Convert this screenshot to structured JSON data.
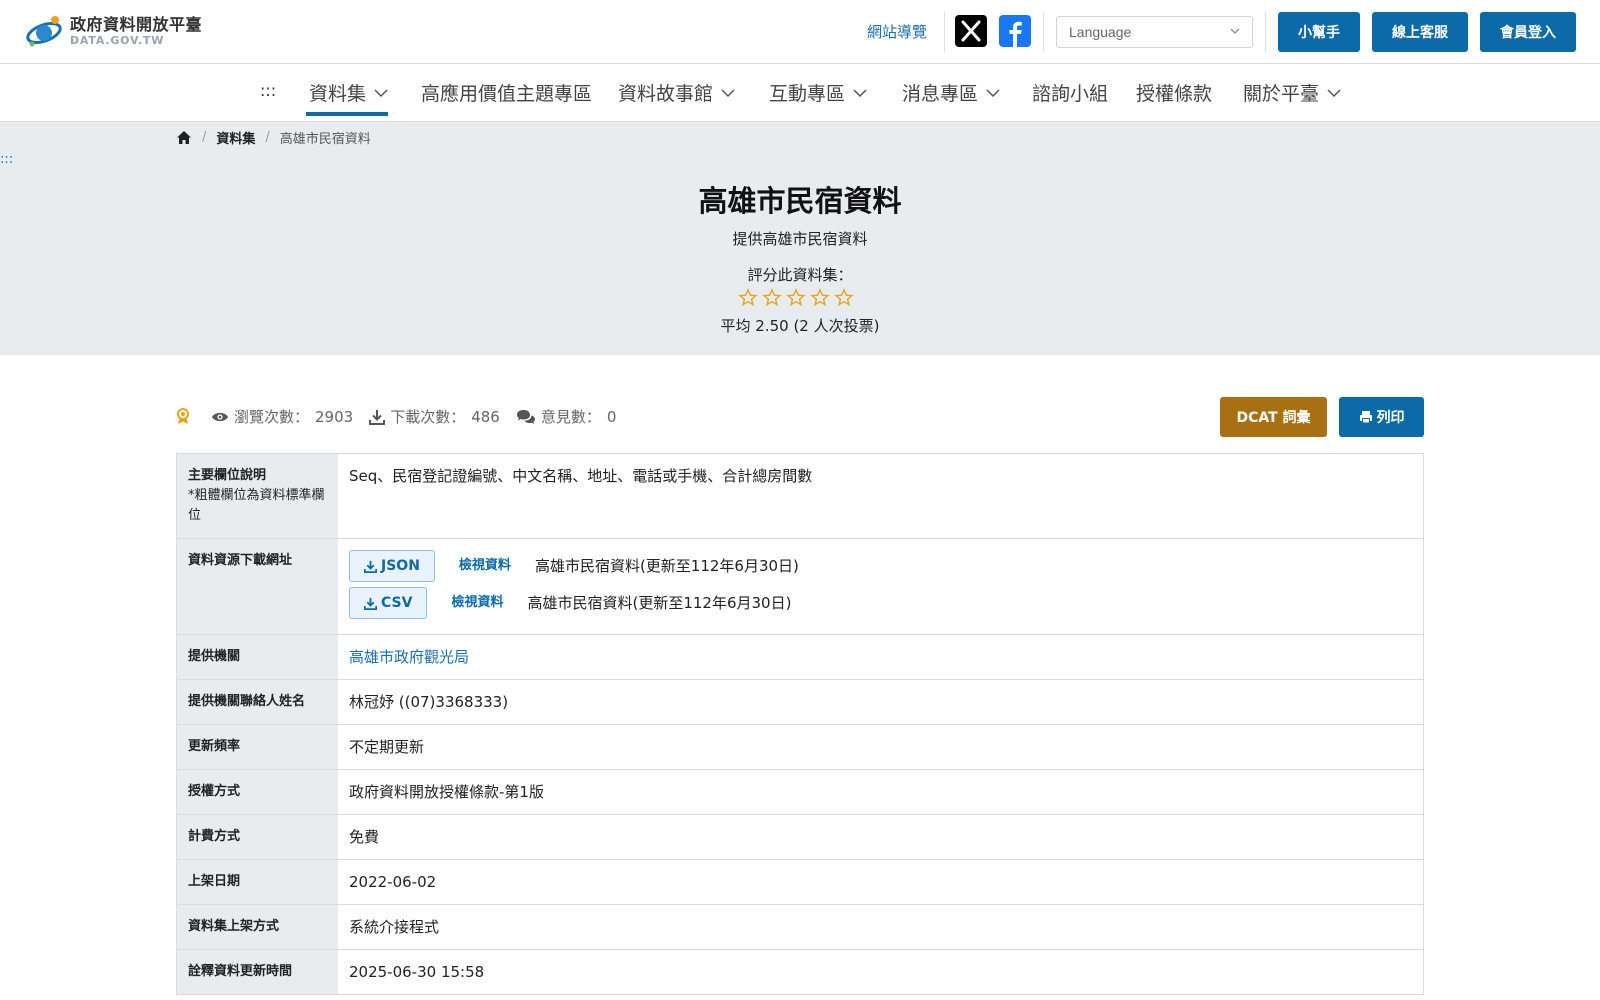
{
  "header": {
    "logo_title": "政府資料開放平臺",
    "logo_sub": "DATA.GOV.TW",
    "sitemap": "網站導覽",
    "language_placeholder": "Language",
    "buttons": {
      "helper": "小幫手",
      "service": "線上客服",
      "login": "會員登入"
    }
  },
  "nav": {
    "dots": ":::",
    "items": [
      "資料集",
      "高應用價值主題專區",
      "資料故事館",
      "互動專區",
      "消息專區",
      "諮詢小組",
      "授權條款",
      "關於平臺"
    ]
  },
  "breadcrumb": {
    "level1": "資料集",
    "current": "高雄市民宿資料"
  },
  "side_dots": ":::",
  "dataset": {
    "title": "高雄市民宿資料",
    "subtitle": "提供高雄市民宿資料",
    "rate_label": "評分此資料集：",
    "rating_stars": 0,
    "average": "平均 2.50 (2 人次投票)"
  },
  "stats": {
    "views_label": "瀏覽次數：",
    "views": "2903",
    "downloads_label": "下載次數：",
    "downloads": "486",
    "comments_label": "意見數：",
    "comments": "0"
  },
  "actions": {
    "dcat": "DCAT 詞彙",
    "print": "列印"
  },
  "details": {
    "fields_label": "主要欄位說明",
    "fields_note": "*粗體欄位為資料標準欄位",
    "fields_value": "Seq、民宿登記證編號、中文名稱、地址、電話或手機、合計總房間數",
    "download_label": "資料資源下載網址",
    "resources": [
      {
        "format": "JSON",
        "view": "檢視資料",
        "desc": "高雄市民宿資料(更新至112年6月30日)"
      },
      {
        "format": "CSV",
        "view": "檢視資料",
        "desc": "高雄市民宿資料(更新至112年6月30日)"
      }
    ],
    "rows": [
      {
        "label": "提供機關",
        "value": "高雄市政府觀光局"
      },
      {
        "label": "提供機關聯絡人姓名",
        "value": "林冠妤 ((07)3368333)"
      },
      {
        "label": "更新頻率",
        "value": "不定期更新"
      },
      {
        "label": "授權方式",
        "value": "政府資料開放授權條款-第1版"
      },
      {
        "label": "計費方式",
        "value": "免費"
      },
      {
        "label": "上架日期",
        "value": "2022-06-02"
      },
      {
        "label": "資料集上架方式",
        "value": "系統介接程式"
      },
      {
        "label": "詮釋資料更新時間",
        "value": "2025-06-30 15:58"
      }
    ]
  },
  "colors": {
    "primary": "#0d6aa8",
    "dcat": "#a87012",
    "banner": "#e9ecef",
    "star": "#e8a317"
  }
}
